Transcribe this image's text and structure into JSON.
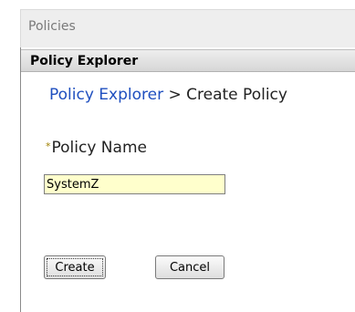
{
  "window": {
    "title": "Policies"
  },
  "portlet": {
    "title": "Policy Explorer"
  },
  "breadcrumb": {
    "link": "Policy Explorer",
    "separator": ">",
    "current": "Create Policy"
  },
  "form": {
    "policy_name_label": "Policy Name",
    "required_marker": "*",
    "policy_name_value": "SystemZ"
  },
  "buttons": {
    "create": "Create",
    "cancel": "Cancel"
  },
  "colors": {
    "link": "#1f4fbf",
    "input_background": "#ffffcc",
    "required_marker": "#a08000"
  }
}
